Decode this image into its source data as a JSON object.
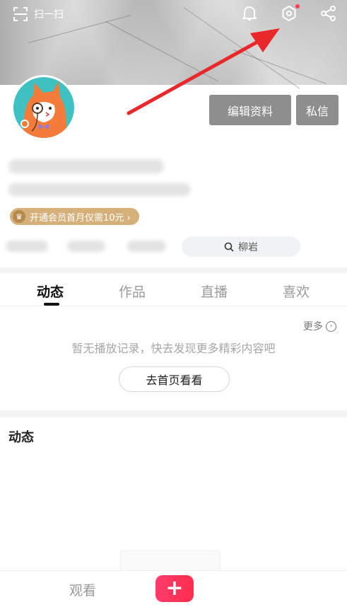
{
  "topbar": {
    "scan_label": "扫一扫",
    "icons": [
      "scan-icon",
      "bell-icon",
      "settings-icon",
      "share-icon"
    ]
  },
  "profile": {
    "edit_button": "编辑资料",
    "message_button": "私信",
    "vip_banner": "开通会员首月仅需10元 ›",
    "search_placeholder": "柳岩"
  },
  "tabs": [
    "动态",
    "作品",
    "直播",
    "喜欢"
  ],
  "history": {
    "more_label": "更多",
    "empty_text": "暂无播放记录，快去发现更多精彩内容吧",
    "home_button": "去首页看看"
  },
  "feed_section": {
    "title": "动态"
  },
  "bottom_nav": {
    "watch_label": "观看",
    "plus_label": "+"
  },
  "colors": {
    "accent": "#ff2e4e",
    "button_gray": "#8e8e8e",
    "vip_gold": "#d6b07a",
    "annotation_red": "#e8282b"
  }
}
